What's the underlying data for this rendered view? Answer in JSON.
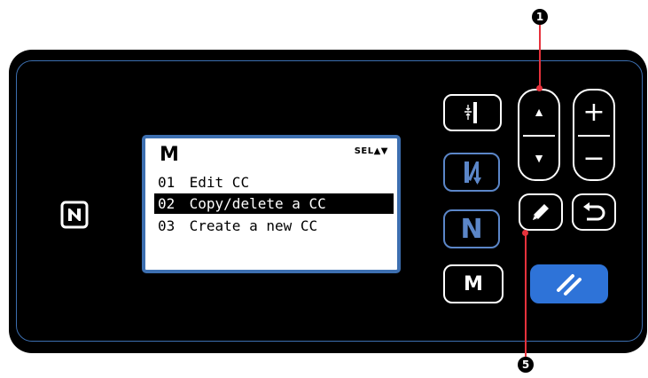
{
  "lcd": {
    "title": "M",
    "sel_indicator": "SEL▲▼",
    "rows": [
      {
        "number": "01",
        "label": "Edit CC",
        "selected": false
      },
      {
        "number": "02",
        "label": "Copy/delete a CC",
        "selected": true
      },
      {
        "number": "03",
        "label": "Create a new CC",
        "selected": false
      }
    ]
  },
  "buttons": {
    "m_label": "M",
    "n_label": "N",
    "plus_label": "+",
    "minus_label": "−",
    "up_label": "▲",
    "down_label": "▼"
  },
  "callouts": {
    "top": "1",
    "bottom": "5"
  },
  "colors": {
    "panel": "#000000",
    "accent_border": "#3c6fb0",
    "reset_button": "#2e73d8",
    "callout_line": "#e6323c"
  },
  "icons": [
    "nfc-icon",
    "thread-trimmer-icon",
    "needle-up-down-icon",
    "n-icon",
    "edit-pen-icon",
    "return-icon",
    "reset-slash-icon"
  ]
}
